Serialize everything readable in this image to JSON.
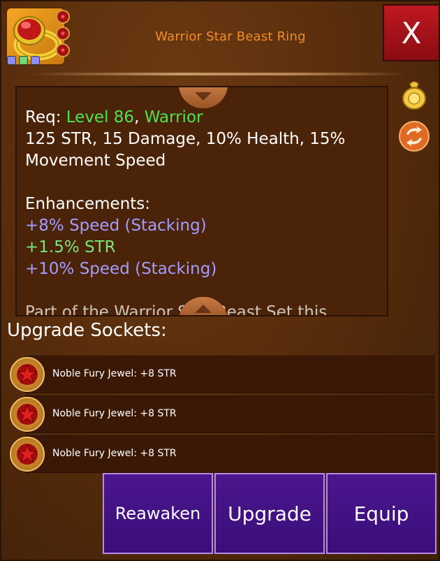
{
  "header": {
    "title": "Warrior Star Beast Ring",
    "close_label": "X",
    "item_icon": "gold-ring-with-red-gem",
    "slot_colors": [
      "#8a8cff",
      "#6ed87a",
      "#8a8cff"
    ],
    "gem_pins": [
      "red-star-gem",
      "red-star-gem",
      "red-star-gem"
    ]
  },
  "description": {
    "req_prefix": "Req: ",
    "req_level": "Level 86",
    "req_sep": ", ",
    "req_class": "Warrior",
    "stats_line": "125 STR, 15 Damage, 10% Health, 15% Movement Speed",
    "enhancements_title": "Enhancements:",
    "enhancements": [
      {
        "text": "+8% Speed (Stacking)",
        "color": "#a39cff"
      },
      {
        "text": "+1.5% STR",
        "color": "#7de37d"
      },
      {
        "text": "+10% Speed (Stacking)",
        "color": "#a39cff"
      }
    ],
    "cutoff_text": "Part of the Warrior Star Beast Set this"
  },
  "side_icons": [
    "coin-bag-icon",
    "swap-icon"
  ],
  "sockets": {
    "label": "Upgrade Sockets:",
    "items": [
      {
        "label": "Noble Fury Jewel: +8 STR",
        "icon": "red-star-jewel"
      },
      {
        "label": "Noble Fury Jewel: +8 STR",
        "icon": "red-star-jewel"
      },
      {
        "label": "Noble Fury Jewel: +8 STR",
        "icon": "red-star-jewel"
      }
    ]
  },
  "buttons": {
    "reawaken": "Reawaken",
    "upgrade": "Upgrade",
    "equip": "Equip"
  },
  "colors": {
    "title": "#f28c2a",
    "req_green": "#4ee24e",
    "enh_purple": "#a39cff",
    "enh_green": "#7de37d",
    "close_red": "#c01820",
    "button_purple": "#4a168e"
  }
}
